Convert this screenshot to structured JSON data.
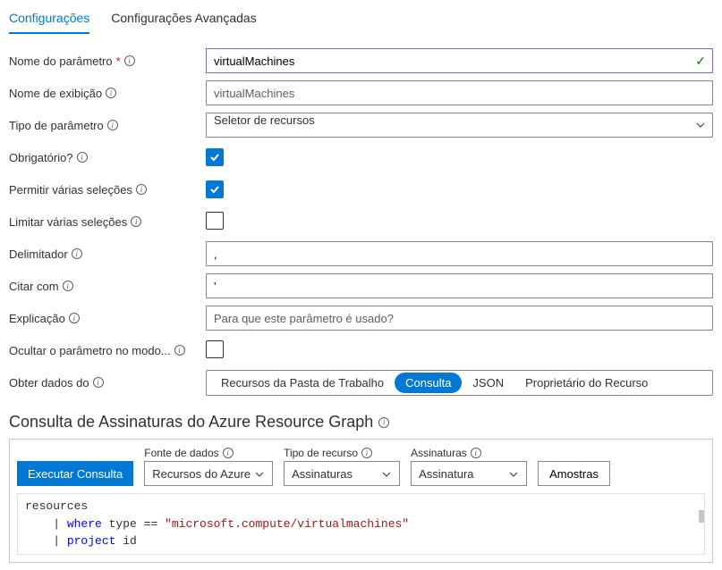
{
  "tabs": {
    "settings": "Configurações",
    "advanced": "Configurações Avançadas"
  },
  "labels": {
    "paramName": "Nome do parâmetro",
    "displayName": "Nome de exibição",
    "paramType": "Tipo de parâmetro",
    "required": "Obrigatório?",
    "multiSelect": "Permitir várias seleções",
    "limitMulti": "Limitar várias seleções",
    "delimiter": "Delimitador",
    "quoteWith": "Citar com",
    "explanation": "Explicação",
    "hideInMode": "Ocultar o parâmetro no modo...",
    "getDataFrom": "Obter dados do"
  },
  "values": {
    "paramName": "virtualMachines",
    "displayNamePlaceholder": "virtualMachines",
    "paramType": "Seletor de recursos",
    "delimiter": ",",
    "quoteWith": "'",
    "explanationPlaceholder": "Para que este parâmetro é usado?"
  },
  "dataSourcePills": {
    "workbook": "Recursos da Pasta de Trabalho",
    "query": "Consulta",
    "json": "JSON",
    "owner": "Proprietário do Recurso"
  },
  "querySection": {
    "title": "Consulta de Assinaturas do Azure Resource Graph",
    "runQuery": "Executar Consulta",
    "dataSourceLabel": "Fonte de dados",
    "dataSourceValue": "Recursos do Azure",
    "resourceTypeLabel": "Tipo de recurso",
    "resourceTypeValue": "Assinaturas",
    "subscriptionsLabel": "Assinaturas",
    "subscriptionsValue": "Assinatura",
    "samples": "Amostras",
    "code": {
      "line1": "resources",
      "line2a": "    | ",
      "line2b": "where",
      "line2c": " type ",
      "line2d": "==",
      "line2e": " \"microsoft.compute/virtualmachines\"",
      "line3a": "    | ",
      "line3b": "project",
      "line3c": " id"
    }
  }
}
